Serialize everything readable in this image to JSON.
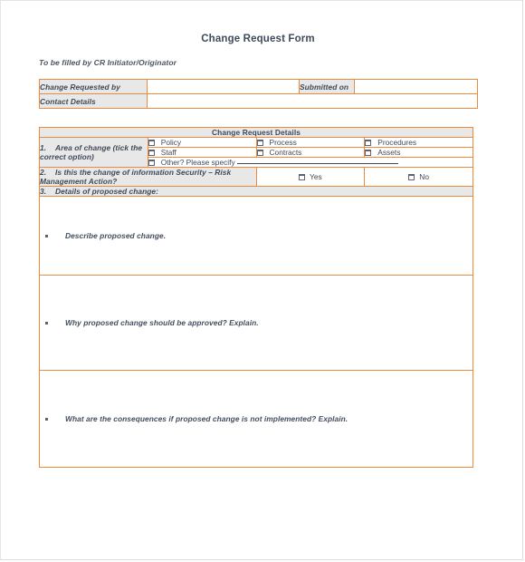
{
  "document": {
    "title": "Change Request Form",
    "subtitle": "To be filled by CR Initiator/Originator"
  },
  "theme": {
    "border_orange": "#ed8b3c",
    "header_gray": "#e8e8e8",
    "text_slate": "#3f4a5a",
    "page_background": "#ffffff"
  },
  "requester_table": {
    "rows": [
      {
        "label": "Change Requested by",
        "value": "",
        "label2": "Submitted on",
        "value2": ""
      },
      {
        "label": "Contact Details",
        "value": ""
      }
    ]
  },
  "details_table": {
    "section_header": "Change Request Details",
    "q1": {
      "number": "1.",
      "text": "Area of change (tick  the correct option)",
      "options": [
        "Policy",
        "Process",
        "Procedures",
        "Staff",
        "Contracts",
        "Assets"
      ],
      "other_label": "Other? Please specify",
      "other_value": ""
    },
    "q2": {
      "number": "2.",
      "text": "Is this the change of information Security – Risk Management Action?",
      "options": [
        "Yes",
        "No"
      ]
    },
    "q3": {
      "number": "3.",
      "text": "Details of proposed change:",
      "prompts": [
        "Describe proposed change.",
        "Why proposed change should be approved? Explain.",
        "What are the consequences if proposed change is not implemented? Explain."
      ],
      "answers": [
        "",
        "",
        ""
      ]
    }
  }
}
